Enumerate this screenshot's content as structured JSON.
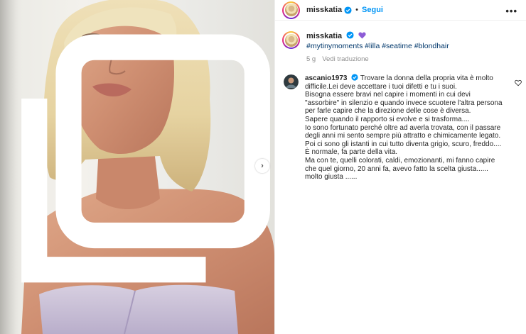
{
  "post": {
    "author": "misskatia",
    "follow_label": "Segui",
    "more_label": "•••",
    "next_label": "›"
  },
  "caption": {
    "author": "misskatia",
    "hashtags": "#mytinymoments #lilla #seatime #blondhair",
    "age": "5 g",
    "translate_label": "Vedi traduzione"
  },
  "comment": {
    "author": "ascanio1973",
    "lines": [
      "Trovare la donna della propria vita è molto",
      "difficile.Lei deve accettare i tuoi difetti e tu i suoi.",
      "Bisogna essere bravi nel capire i momenti in cui devi",
      "\"assorbire\" in silenzio e quando invece scuotere l'altra persona",
      "per farle capire che la direzione delle cose è diversa.",
      "Sapere quando il rapporto si evolve e si trasforma....",
      "Io sono fortunato perché oltre ad averla trovata, con il passare",
      "degli anni mi sento sempre più attratto e chimicamente legato.",
      "Poi ci sono gli istanti in cui tutto diventa grigio, scuro, freddo....",
      "È normale, fa parte della vita.",
      "Ma con te, quelli colorati, caldi, emozionanti, mi fanno capire",
      "che quel giorno, 20 anni fa, avevo fatto la scelta giusta......",
      "molto giusta ......"
    ]
  },
  "icons": {
    "verified": "verified-badge-icon",
    "caption_emoji": "purple-heart-icon",
    "comment_like": "heart-outline-icon",
    "carousel": "multiple-images-icon",
    "next": "chevron-right-icon"
  },
  "colors": {
    "link_blue": "#0095f6",
    "hashtag_blue": "#00376b",
    "verified_blue": "#0095f6",
    "heart_purple": "#8d5cd6",
    "swimsuit_lilac": "#c9bfd6"
  }
}
